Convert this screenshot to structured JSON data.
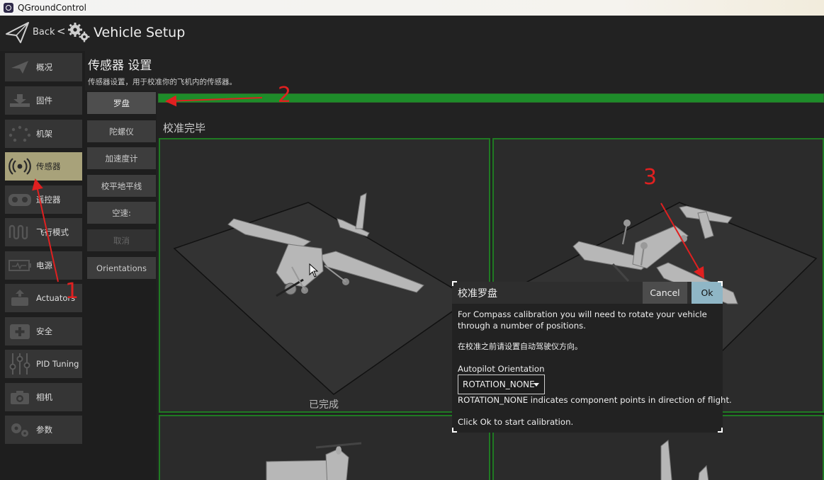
{
  "window": {
    "title": "QGroundControl"
  },
  "topbar": {
    "back_label": "Back",
    "separator": "<",
    "title": "Vehicle Setup"
  },
  "sidebar": {
    "items": [
      {
        "label": "概况",
        "icon": "plane-icon"
      },
      {
        "label": "固件",
        "icon": "download-icon"
      },
      {
        "label": "机架",
        "icon": "airframe-icon"
      },
      {
        "label": "传感器",
        "icon": "sensors-icon",
        "active": true
      },
      {
        "label": "遥控器",
        "icon": "radio-icon"
      },
      {
        "label": "飞行模式",
        "icon": "flight-modes-icon"
      },
      {
        "label": "电源",
        "icon": "battery-icon"
      },
      {
        "label": "Actuators",
        "icon": "actuators-icon"
      },
      {
        "label": "安全",
        "icon": "safety-icon"
      },
      {
        "label": "PID Tuning",
        "icon": "tuning-icon"
      },
      {
        "label": "相机",
        "icon": "camera-icon"
      },
      {
        "label": "参数",
        "icon": "parameters-icon"
      }
    ]
  },
  "sensors": {
    "title": "传感器 设置",
    "description": "传感器设置，用于校准你的飞机内的传感器。",
    "buttons": [
      "罗盘",
      "陀螺仪",
      "加速度计",
      "校平地平线",
      "空速:",
      "取消",
      "Orientations"
    ],
    "progress": 1.0,
    "status": "校准完毕",
    "done_label": "已完成"
  },
  "dialog": {
    "title": "校准罗盘",
    "cancel_label": "Cancel",
    "ok_label": "Ok",
    "intro_line1": "For Compass calibration you will need to rotate your vehicle",
    "intro_line2": "through a number of positions.",
    "note": "在校准之前请设置自动驾驶仪方向。",
    "orientation_label": "Autopilot Orientation",
    "orientation_value": "ROTATION_NONE",
    "orientation_hint": "ROTATION_NONE indicates component points in direction of flight.",
    "footer": "Click Ok to start calibration."
  },
  "annotations": [
    "1",
    "2",
    "3"
  ],
  "colors": {
    "active": "#a8a27a",
    "progress": "#1e8c2a",
    "ok_button": "#8fb6c6",
    "annotation": "#e02020"
  }
}
